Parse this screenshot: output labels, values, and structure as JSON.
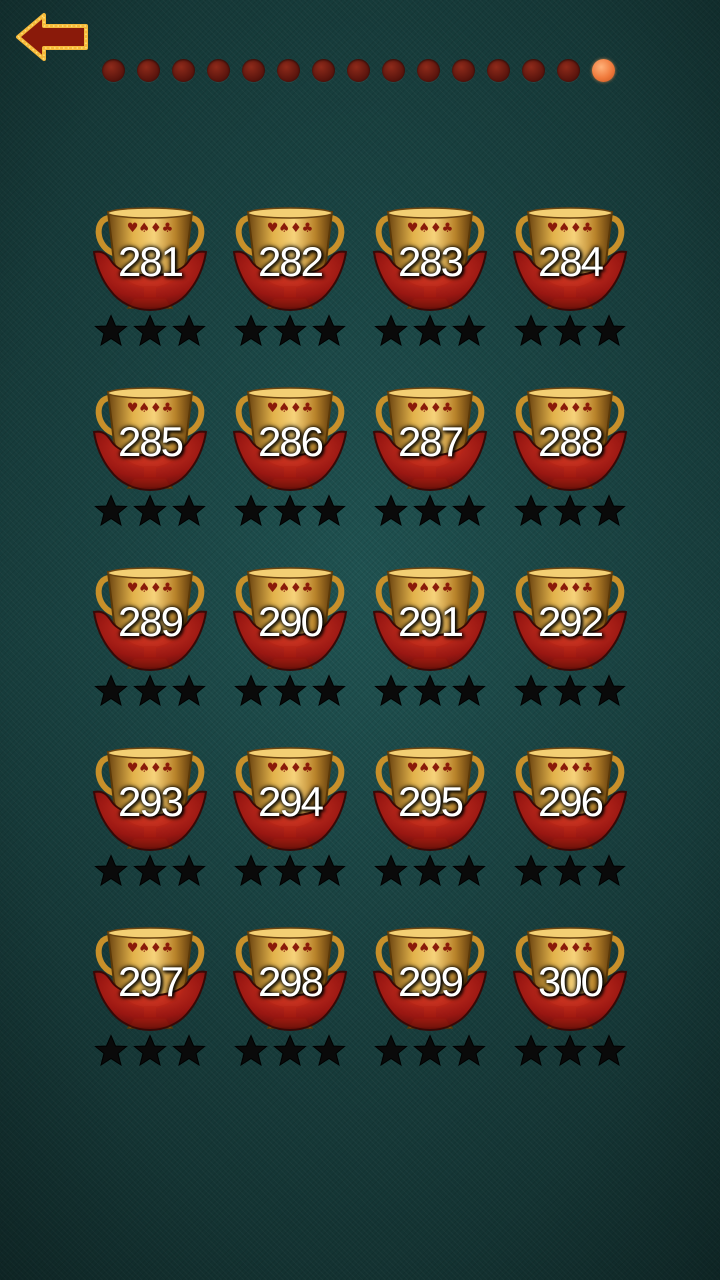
{
  "navigation": {
    "back_icon": "arrow-left-icon",
    "page_count": 15,
    "active_page": 15
  },
  "levels": [
    {
      "number": "281",
      "stars_earned": 0
    },
    {
      "number": "282",
      "stars_earned": 0
    },
    {
      "number": "283",
      "stars_earned": 0
    },
    {
      "number": "284",
      "stars_earned": 0
    },
    {
      "number": "285",
      "stars_earned": 0
    },
    {
      "number": "286",
      "stars_earned": 0
    },
    {
      "number": "287",
      "stars_earned": 0
    },
    {
      "number": "288",
      "stars_earned": 0
    },
    {
      "number": "289",
      "stars_earned": 0
    },
    {
      "number": "290",
      "stars_earned": 0
    },
    {
      "number": "291",
      "stars_earned": 0
    },
    {
      "number": "292",
      "stars_earned": 0
    },
    {
      "number": "293",
      "stars_earned": 0
    },
    {
      "number": "294",
      "stars_earned": 0
    },
    {
      "number": "295",
      "stars_earned": 0
    },
    {
      "number": "296",
      "stars_earned": 0
    },
    {
      "number": "297",
      "stars_earned": 0
    },
    {
      "number": "298",
      "stars_earned": 0
    },
    {
      "number": "299",
      "stars_earned": 0
    },
    {
      "number": "300",
      "stars_earned": 0
    }
  ],
  "stars_per_level": 3,
  "colors": {
    "background": "#1f5251",
    "dot_inactive": "#5e160e",
    "dot_active": "#f07a3c",
    "trophy_gold": "#c8902a",
    "trophy_ribbon": "#b01c12",
    "star_empty": "#0a0a0a",
    "back_arrow": "#8a1a0a",
    "back_border": "#f5b93a"
  }
}
